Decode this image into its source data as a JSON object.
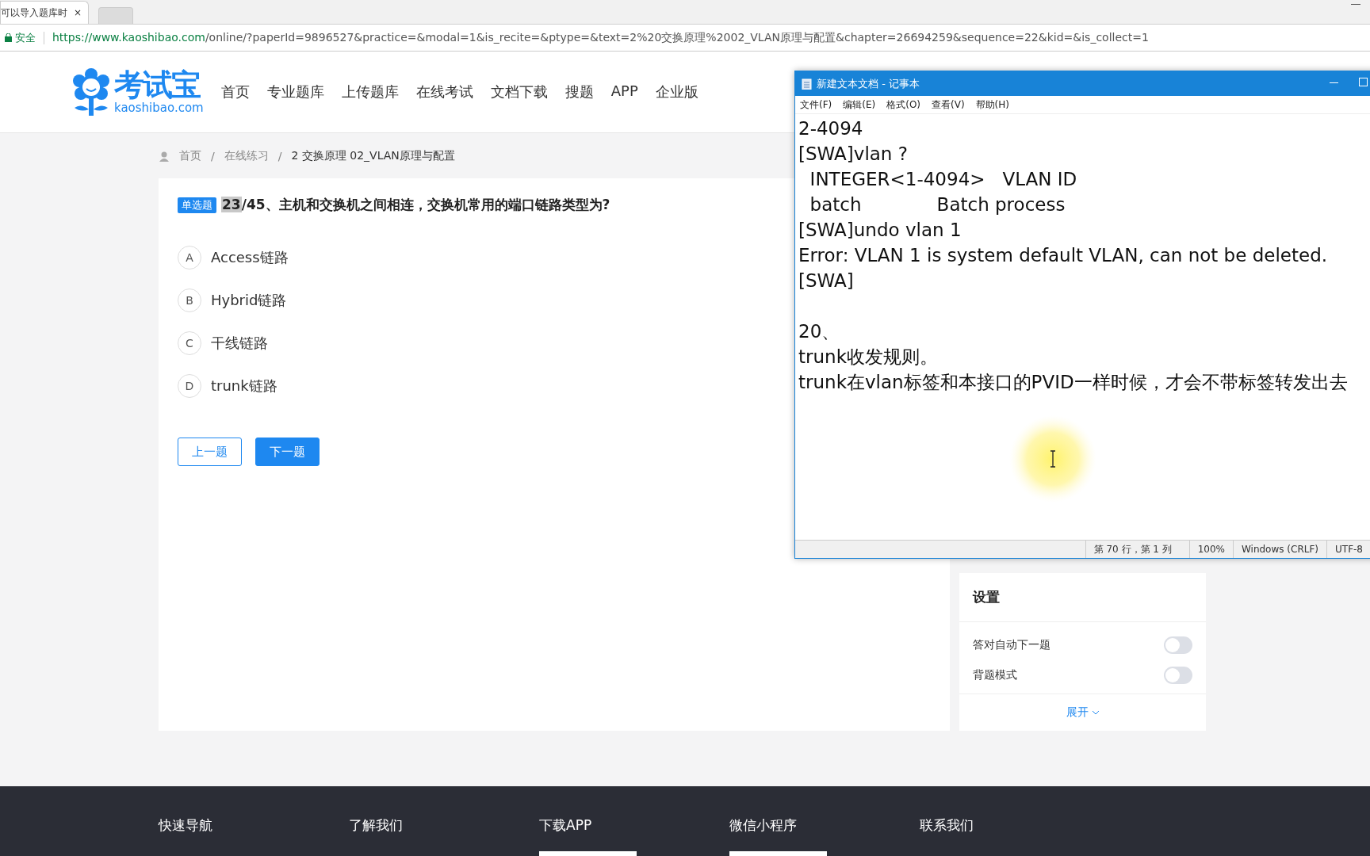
{
  "browser": {
    "tabs": [
      {
        "title": "可以导入题库时",
        "close": "×",
        "selected": true
      },
      {
        "selected": false
      }
    ],
    "secure_label": "安全",
    "url_host": "https://www.kaoshibao.com",
    "url_path": "/online/?paperId=9896527&practice=&modal=1&is_recite=&ptype=&text=2%20交换原理%2002_VLAN原理与配置&chapter=26694259&sequence=22&kid=&is_collect=1"
  },
  "header": {
    "logo_name": "考试宝",
    "logo_domain": "kaoshibao.com",
    "nav": [
      {
        "label": "首页"
      },
      {
        "label": "专业题库"
      },
      {
        "label": "上传题库"
      },
      {
        "label": "在线考试"
      },
      {
        "label": "文档下载"
      },
      {
        "label": "搜题"
      },
      {
        "label": "APP"
      },
      {
        "label": "企业版"
      }
    ]
  },
  "breadcrumb": {
    "items": [
      "首页",
      "在线练习",
      "2 交换原理 02_VLAN原理与配置"
    ],
    "separators": [
      "/",
      "/"
    ]
  },
  "question": {
    "type_badge": "单选题",
    "number": "23",
    "number_highlighted": true,
    "text": "/45、主机和交换机之间相连，交换机常用的端口链路类型为?",
    "options": [
      {
        "letter": "A",
        "text": "Access链路",
        "selected": false
      },
      {
        "letter": "B",
        "text": "Hybrid链路",
        "selected": false
      },
      {
        "letter": "C",
        "text": "干线链路",
        "selected": false
      },
      {
        "letter": "D",
        "text": "trunk链路",
        "selected": false
      }
    ],
    "buttons": [
      {
        "label": "上一题",
        "kind": "outline"
      },
      {
        "label": "下一题",
        "kind": "primary"
      }
    ]
  },
  "settings": {
    "title": "设置",
    "toggles": [
      {
        "label": "答对自动下一题",
        "on": false
      },
      {
        "label": "背题模式",
        "on": false
      }
    ],
    "expand": "展开"
  },
  "notepad": {
    "title": "新建文本文档 - 记事本",
    "menu": [
      "文件(F)",
      "编辑(E)",
      "格式(O)",
      "查看(V)",
      "帮助(H)"
    ],
    "paragraphs": [
      [
        "2-4094",
        "[SWA]vlan ?",
        "  INTEGER<1-4094>   VLAN ID",
        "  batch             Batch process",
        "[SWA]undo vlan 1",
        "Error: VLAN 1 is system default VLAN, can not be deleted.",
        "[SWA]"
      ],
      [
        "20、",
        "trunk收发规则。",
        "trunk在vlan标签和本接口的PVID一样时候，才会不带标签转发出去"
      ]
    ],
    "status": [
      "第 70 行，第 1 列",
      "100%",
      "Windows (CRLF)",
      "UTF-8"
    ]
  },
  "footer": [
    {
      "label": "快速导航"
    },
    {
      "label": "了解我们"
    },
    {
      "label": "下载APP"
    },
    {
      "label": "微信小程序"
    },
    {
      "label": "联系我们"
    }
  ]
}
